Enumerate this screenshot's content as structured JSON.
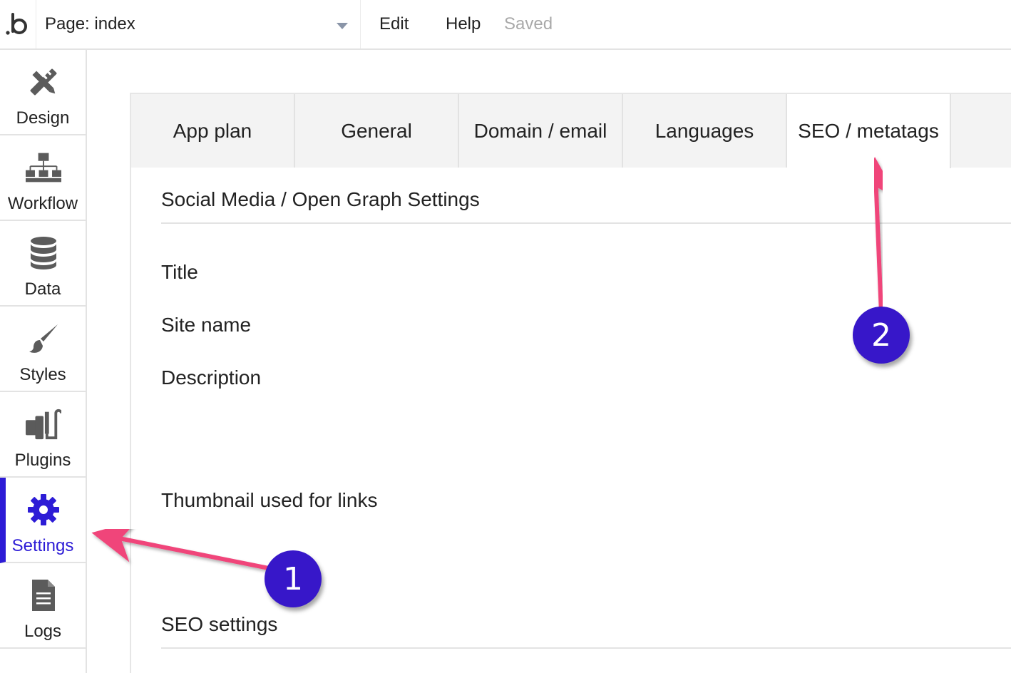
{
  "topbar": {
    "logo": "b-logo",
    "page_label": "Page: index",
    "menu": {
      "edit": "Edit",
      "help": "Help",
      "status": "Saved"
    }
  },
  "sidebar": {
    "items": [
      {
        "label": "Design",
        "icon": "design-tools-icon"
      },
      {
        "label": "Workflow",
        "icon": "workflow-tree-icon"
      },
      {
        "label": "Data",
        "icon": "database-icon"
      },
      {
        "label": "Styles",
        "icon": "paintbrush-icon"
      },
      {
        "label": "Plugins",
        "icon": "plugin-plug-icon"
      },
      {
        "label": "Settings",
        "icon": "gear-icon",
        "active": true
      },
      {
        "label": "Logs",
        "icon": "document-icon"
      }
    ],
    "accent": "#2d1cd6"
  },
  "tabs": [
    {
      "label": "App plan"
    },
    {
      "label": "General"
    },
    {
      "label": "Domain / email"
    },
    {
      "label": "Languages"
    },
    {
      "label": "SEO / metatags",
      "active": true
    }
  ],
  "content": {
    "section_og": "Social Media / Open Graph Settings",
    "fields": {
      "title": "Title",
      "site_name": "Site name",
      "description": "Description",
      "thumbnail": "Thumbnail used for links"
    },
    "section_seo": "SEO settings"
  },
  "annotations": {
    "badge_1": "1",
    "badge_2": "2",
    "arrow_color": "#f0457a",
    "badge_color": "#3717c9"
  }
}
